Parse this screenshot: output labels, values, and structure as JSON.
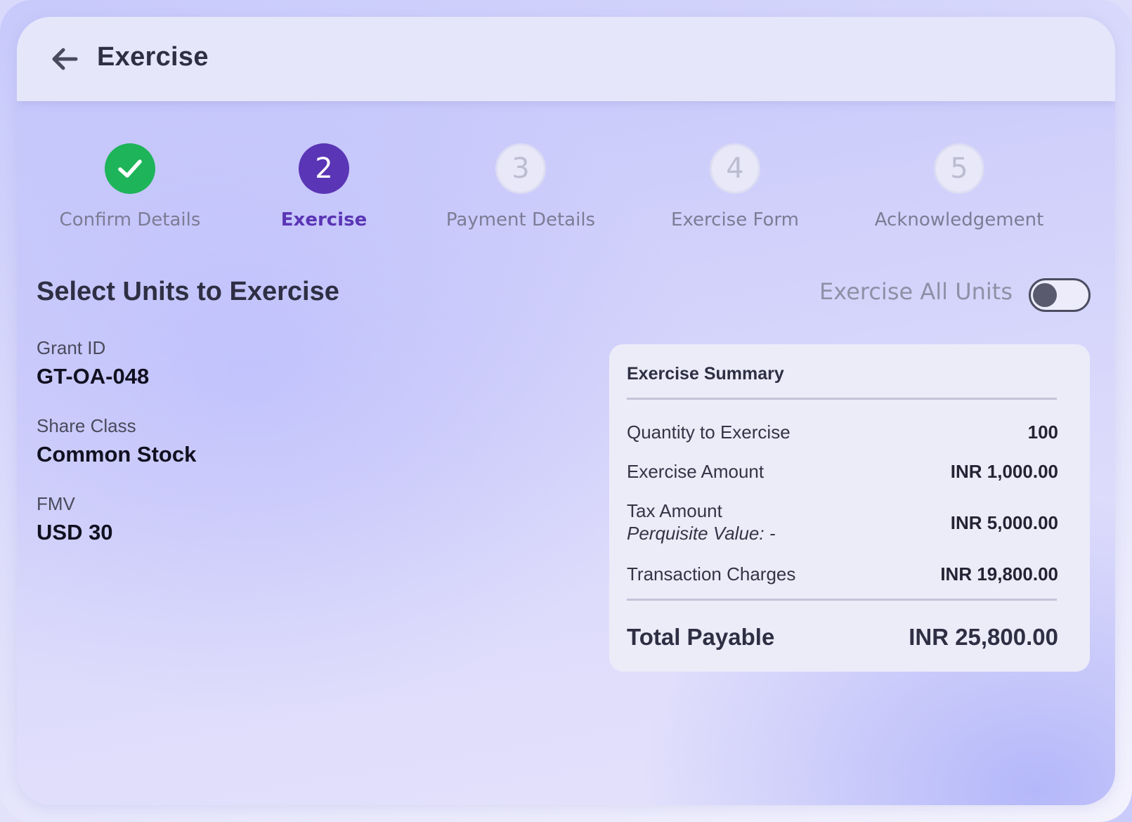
{
  "header": {
    "title": "Exercise",
    "back_icon": "arrow-left-icon"
  },
  "stepper": {
    "steps": [
      {
        "number": "1",
        "label": "Confirm Details",
        "status": "completed"
      },
      {
        "number": "2",
        "label": "Exercise",
        "status": "active"
      },
      {
        "number": "3",
        "label": "Payment Details",
        "status": "pending"
      },
      {
        "number": "4",
        "label": "Exercise Form",
        "status": "pending"
      },
      {
        "number": "5",
        "label": "Acknowledgement",
        "status": "pending"
      }
    ]
  },
  "section": {
    "title": "Select Units to Exercise"
  },
  "toggle": {
    "label": "Exercise All Units",
    "checked": false
  },
  "details": {
    "grant_id_label": "Grant  ID",
    "grant_id_value": "GT-OA-048",
    "share_class_label": "Share Class",
    "share_class_value": "Common Stock",
    "fmv_label": "FMV",
    "fmv_value": "USD 30"
  },
  "summary": {
    "title": "Exercise Summary",
    "rows": [
      {
        "label": "Quantity to Exercise",
        "value": "100"
      },
      {
        "label": "Exercise Amount",
        "value": "INR 1,000.00"
      },
      {
        "label": "Tax Amount",
        "sublabel": "Perquisite Value: -",
        "value": "INR 5,000.00"
      },
      {
        "label": "Transaction Charges",
        "value": "INR 19,800.00"
      }
    ],
    "total_label": "Total Payable",
    "total_value": "INR 25,800.00"
  },
  "colors": {
    "accent": "#5a35b5",
    "success": "#1eb45a",
    "text_dark": "#2f2f44"
  }
}
